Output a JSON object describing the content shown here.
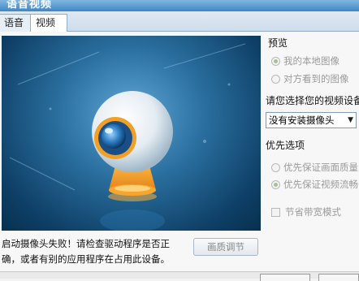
{
  "window": {
    "title": "语音视频"
  },
  "tabs": [
    {
      "label": "语音"
    },
    {
      "label": "视频"
    }
  ],
  "preview_group": {
    "title": "预览",
    "options": [
      {
        "label": "我的本地图像",
        "selected": true
      },
      {
        "label": "对方看到的图像",
        "selected": false
      }
    ]
  },
  "device": {
    "label": "请您选择您的视频设备",
    "selected": "没有安装摄像头"
  },
  "priority_group": {
    "title": "优先选项",
    "options": [
      {
        "label": "优先保证画面质量",
        "selected": false
      },
      {
        "label": "优先保证视频流畅",
        "selected": true
      }
    ]
  },
  "bandwidth": {
    "label": "节省带宽模式",
    "checked": false
  },
  "error": {
    "line1": "启动摄像头失败！请检查驱动程序是否正",
    "line2": "确，或者有别的应用程序在占用此设备。"
  },
  "quality_button": {
    "label": "画质调节"
  },
  "colors": {
    "accent": "#3f86c6",
    "preview_bg": "#0e3f66",
    "camera_ring": "#f39c1e"
  }
}
